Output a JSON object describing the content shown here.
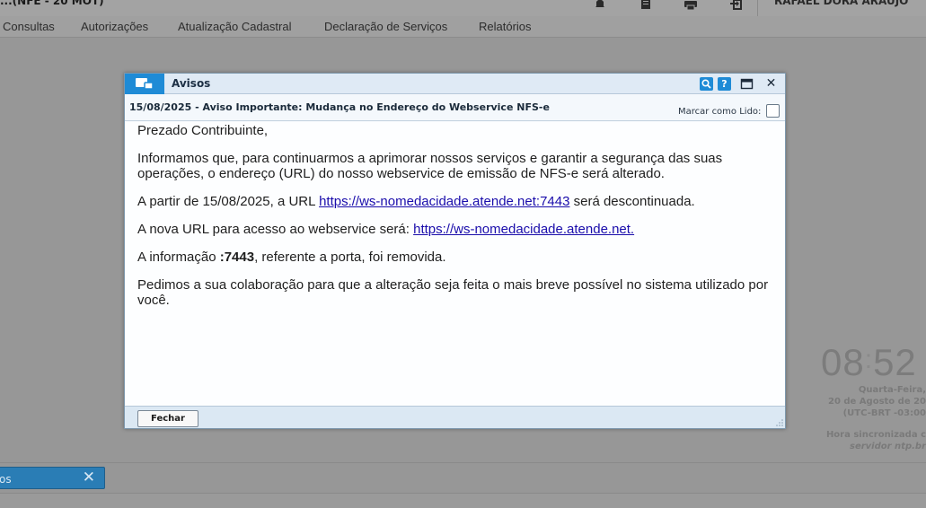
{
  "topbar": {
    "title_fragment": "...(NFE - 20 MOT)",
    "user_fragment": "RAFAEL DORA ARAUJO",
    "icons": [
      "bell-icon",
      "document-icon",
      "printer-icon",
      "export-icon"
    ]
  },
  "menu": {
    "items": [
      {
        "label": "Consultas"
      },
      {
        "label": "Autorizações"
      },
      {
        "label": "Atualização Cadastral"
      },
      {
        "label": "Declaração de Serviços"
      },
      {
        "label": "Relatórios"
      }
    ]
  },
  "clock": {
    "time_hours": "08",
    "time_minutes": "52",
    "weekday": "Quarta-Feira,",
    "date": "20 de Agosto de 20",
    "timezone": "(UTC-BRT -03:00",
    "sync_line1": "Hora sincronizada c",
    "sync_line2": "servidor ntp.br"
  },
  "bottom_tab": {
    "label": "os",
    "close": "✕"
  },
  "modal": {
    "title": "Avisos",
    "message_title": "15/08/2025 - Aviso Importante: Mudança no Endereço do Webservice NFS-e",
    "mark_read_label": "Marcar como Lido:",
    "mark_read_checked": false,
    "close_button_label": "Fechar",
    "colors": {
      "accent": "#1f8bd6",
      "link": "#1a0dab"
    },
    "body": {
      "greeting": "Prezado Contribuinte,",
      "p1": "Informamos que, para continuarmos a aprimorar nossos serviços e garantir a segurança das suas operações, o endereço (URL) do nosso webservice de emissão de NFS-e será alterado.",
      "p2_before": "A partir de 15/08/2025, a URL ",
      "p2_link": "https://ws-nomedacidade.atende.net:7443",
      "p2_after": " será descontinuada.",
      "p3_before": "A nova URL para acesso ao webservice será: ",
      "p3_link": "https://ws-nomedacidade.atende.net.",
      "p4_before": "A informação ",
      "p4_bold": ":7443",
      "p4_after": ", referente a porta, foi removida.",
      "p5": "Pedimos a sua colaboração para que a alteração seja feita o mais breve possível no sistema utilizado por você."
    }
  }
}
